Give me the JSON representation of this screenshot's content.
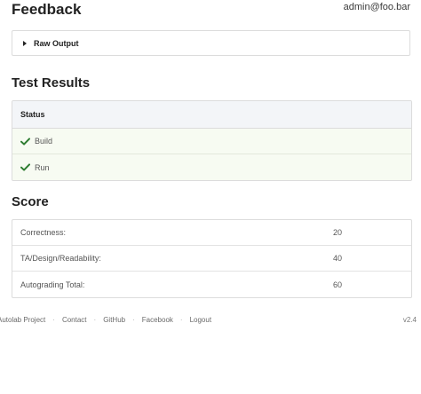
{
  "header": {
    "title": "Feedback",
    "user_email": "admin@foo.bar"
  },
  "raw_output": {
    "label": "Raw Output"
  },
  "test_results": {
    "title": "Test Results",
    "column_header": "Status",
    "rows": [
      {
        "label": "Build",
        "status": "passed"
      },
      {
        "label": "Run",
        "status": "passed"
      }
    ],
    "pass_color": "#2e7d32"
  },
  "score": {
    "title": "Score",
    "rows": [
      {
        "name": "Correctness:",
        "value": "20"
      },
      {
        "name": "TA/Design/Readability:",
        "value": "40"
      },
      {
        "name": "Autograding Total:",
        "value": "60"
      }
    ]
  },
  "footer": {
    "links": [
      "Autolab Project",
      "Contact",
      "GitHub",
      "Facebook",
      "Logout"
    ],
    "separator": "·",
    "version": "v2.4"
  }
}
